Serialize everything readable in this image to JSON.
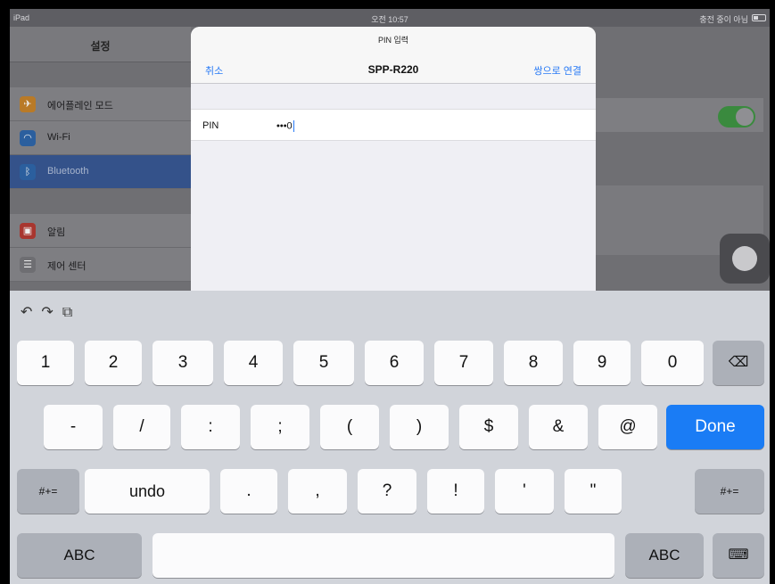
{
  "status_bar": {
    "device": "iPad",
    "time": "오전 10:57",
    "charging": "충전 중이 아님"
  },
  "settings": {
    "title": "설정",
    "items": [
      {
        "label": "에어플레인 모드",
        "icon": "airplane-icon",
        "color": "#d08a2a"
      },
      {
        "label": "Wi-Fi",
        "icon": "wifi-icon",
        "color": "#2b6fb8"
      },
      {
        "label": "Bluetooth",
        "icon": "bluetooth-icon",
        "color": "#2b6fb8",
        "selected": true
      },
      {
        "label": "알림",
        "icon": "notifications-icon",
        "color": "#c23b33"
      },
      {
        "label": "제어 센터",
        "icon": "control-center-icon",
        "color": "#8a8a8e"
      }
    ]
  },
  "dialog": {
    "prompt": "PIN 입력",
    "title": "SPP-R220",
    "cancel_label": "취소",
    "pair_label": "쌍으로 연결",
    "pin_label": "PIN",
    "pin_value": "•••0"
  },
  "keyboard": {
    "toolbar_icons": [
      "undo-icon",
      "redo-icon",
      "paste-icon"
    ],
    "row1": [
      "1",
      "2",
      "3",
      "4",
      "5",
      "6",
      "7",
      "8",
      "9",
      "0"
    ],
    "row2": [
      "-",
      "/",
      ":",
      ";",
      "(",
      ")",
      "$",
      "&",
      "@"
    ],
    "done_label": "Done",
    "row3_left": "#+=",
    "undo_label": "undo",
    "row3": [
      ".",
      ",",
      "?",
      "!",
      "'",
      "\""
    ],
    "row3_right": "#+=",
    "abc_left": "ABC",
    "abc_right": "ABC"
  },
  "colors": {
    "accent": "#2a7bf6",
    "done": "#1a7cf5",
    "toggle_on": "#3a8a3e"
  }
}
